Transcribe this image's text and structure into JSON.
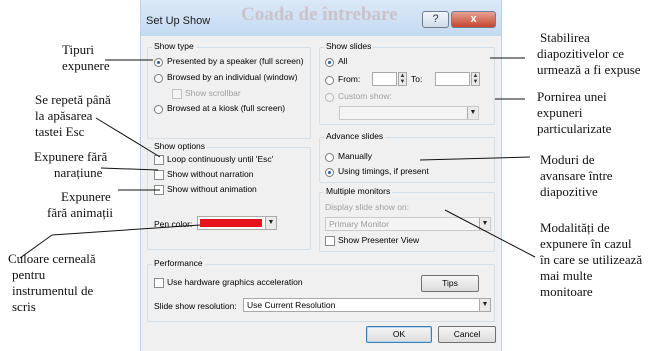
{
  "dialog": {
    "title": "Set Up Show",
    "watermark": "Coada de întrebare",
    "help_label": "?",
    "close_label": "x"
  },
  "show_type": {
    "label": "Show type",
    "presented": "Presented by a speaker (full screen)",
    "browsed_individual": "Browsed by an individual (window)",
    "show_scrollbar": "Show scrollbar",
    "browsed_kiosk": "Browsed at a kiosk (full screen)",
    "selected": "presented"
  },
  "show_options": {
    "label": "Show options",
    "loop": "Loop continuously until 'Esc'",
    "no_narration": "Show without narration",
    "no_animation": "Show without animation",
    "pen_color_label": "Pen color:",
    "pen_color": "#e8141c"
  },
  "show_slides": {
    "label": "Show slides",
    "all": "All",
    "from": "From:",
    "to": "To:",
    "custom": "Custom show:",
    "selected": "all"
  },
  "advance_slides": {
    "label": "Advance slides",
    "manually": "Manually",
    "timings": "Using timings, if present",
    "selected": "timings"
  },
  "multiple_monitors": {
    "label": "Multiple monitors",
    "display_on": "Display slide show on:",
    "monitor_value": "Primary Monitor",
    "presenter_view": "Show Presenter View"
  },
  "performance": {
    "label": "Performance",
    "hw_accel": "Use hardware graphics acceleration",
    "tips": "Tips",
    "resolution_label": "Slide show resolution:",
    "resolution_value": "Use Current Resolution"
  },
  "buttons": {
    "ok": "OK",
    "cancel": "Cancel"
  },
  "annotations": {
    "tipuri": [
      "Tipuri",
      "expunere"
    ],
    "repeta": [
      "Se repetă până",
      "la apăsarea",
      "tastei Esc"
    ],
    "narat": [
      "Expunere fără",
      "narațiune"
    ],
    "anim": [
      "Expunere",
      "fără animații"
    ],
    "culoare": [
      "Culoare cerneală",
      "pentru",
      "instrumentul de",
      "scris"
    ],
    "stabilirea": [
      "Stabilirea",
      "diapozitivelor ce",
      "urmează a fi expuse"
    ],
    "pornirea": [
      "Pornirea unei",
      "expuneri",
      "particularizate"
    ],
    "moduri": [
      "Moduri de",
      "avansare între",
      "diapozitive"
    ],
    "modalitati": [
      "Modalități de",
      "expunere în cazul",
      "în care se utilizează",
      "mai multe",
      "monitoare"
    ]
  }
}
